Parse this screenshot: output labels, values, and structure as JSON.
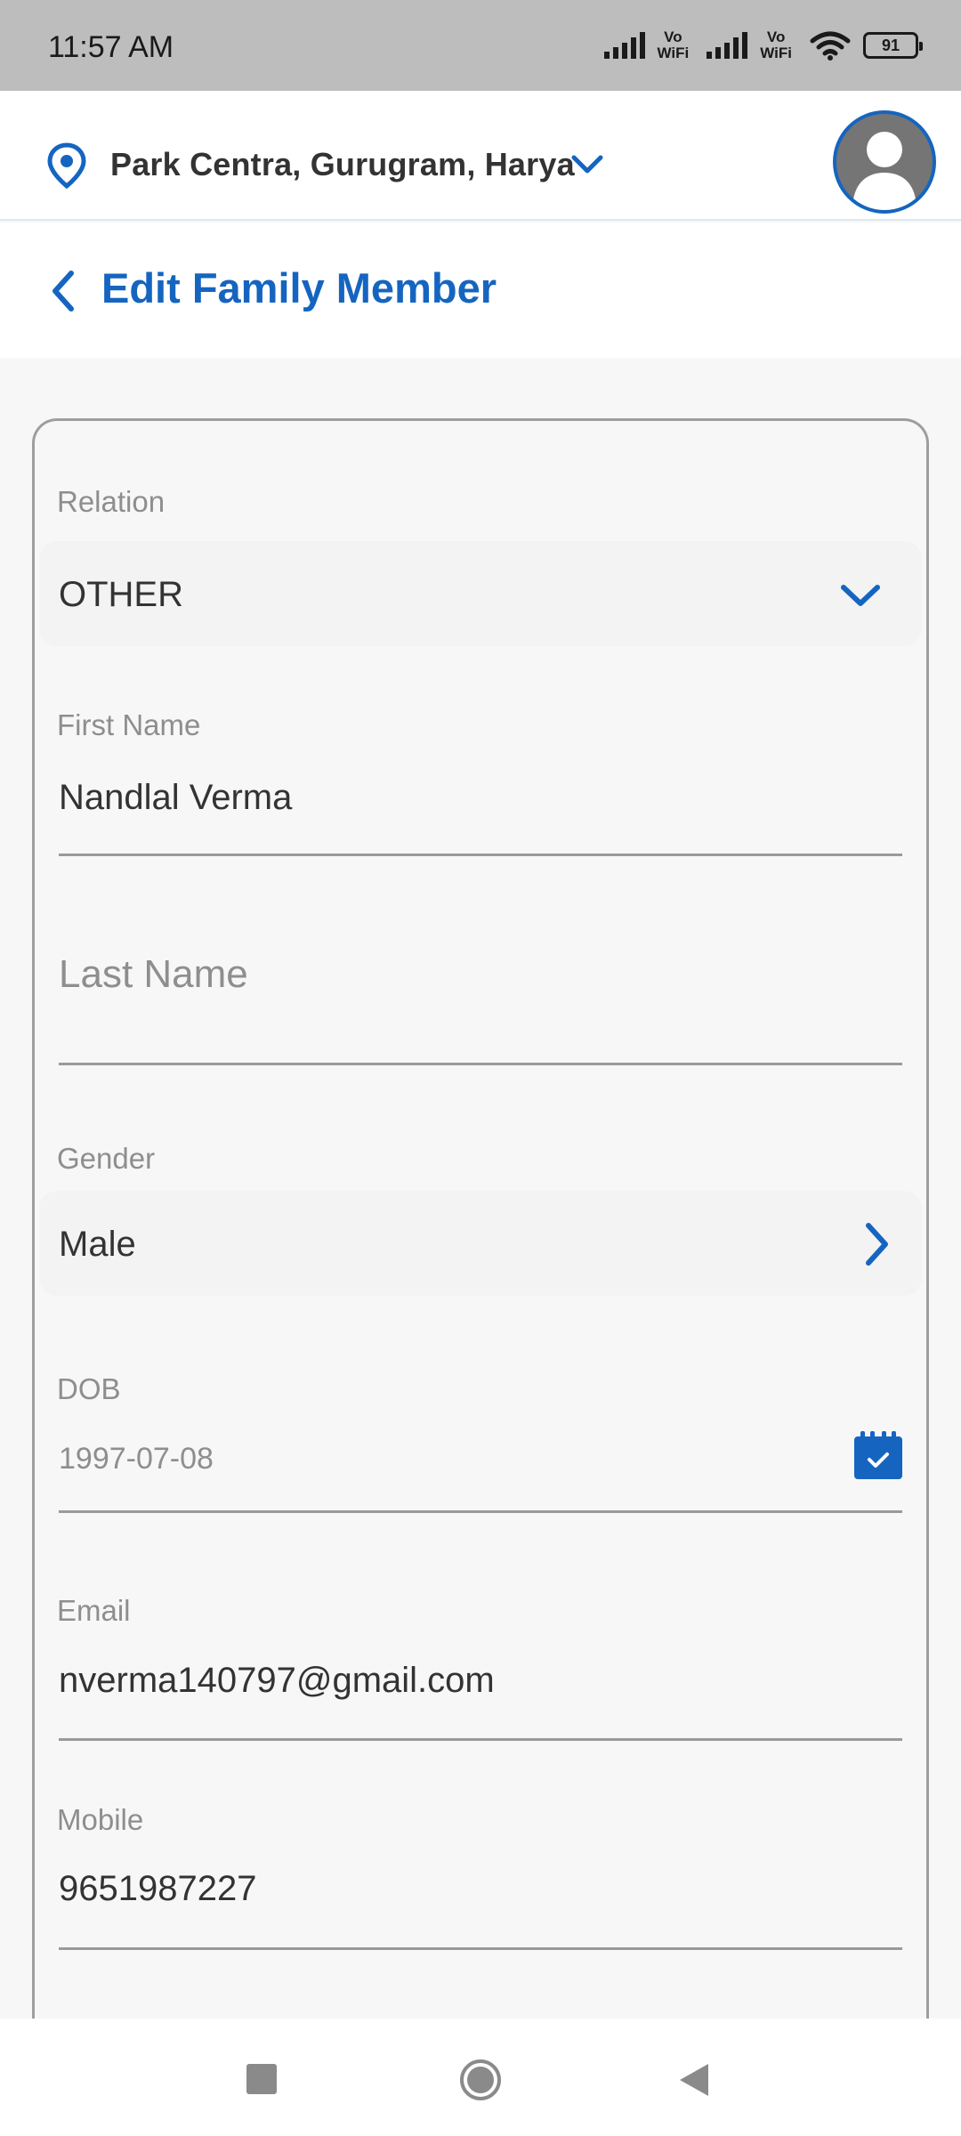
{
  "status_bar": {
    "time": "11:57 AM",
    "vowifi_top": "Vo",
    "vowifi_bottom": "WiFi",
    "battery": "91"
  },
  "header": {
    "location": "Park Centra, Gurugram, Harya",
    "location_icon": "location-pin-icon",
    "dropdown_icon": "chevron-down-icon",
    "avatar_icon": "user-avatar-icon"
  },
  "page": {
    "title": "Edit Family Member",
    "back_icon": "chevron-left-icon"
  },
  "form": {
    "relation": {
      "label": "Relation",
      "value": "OTHER"
    },
    "first_name": {
      "label": "First Name",
      "value": "Nandlal Verma"
    },
    "last_name": {
      "placeholder": "Last Name",
      "value": ""
    },
    "gender": {
      "label": "Gender",
      "value": "Male"
    },
    "dob": {
      "label": "DOB",
      "value": "1997-07-08"
    },
    "email": {
      "label": "Email",
      "value": "nverma140797@gmail.com"
    },
    "mobile": {
      "label": "Mobile",
      "value": "9651987227"
    }
  },
  "colors": {
    "accent": "#1565c0",
    "status_bar": "#bdbdbd",
    "label_gray": "#8e8e8e"
  }
}
